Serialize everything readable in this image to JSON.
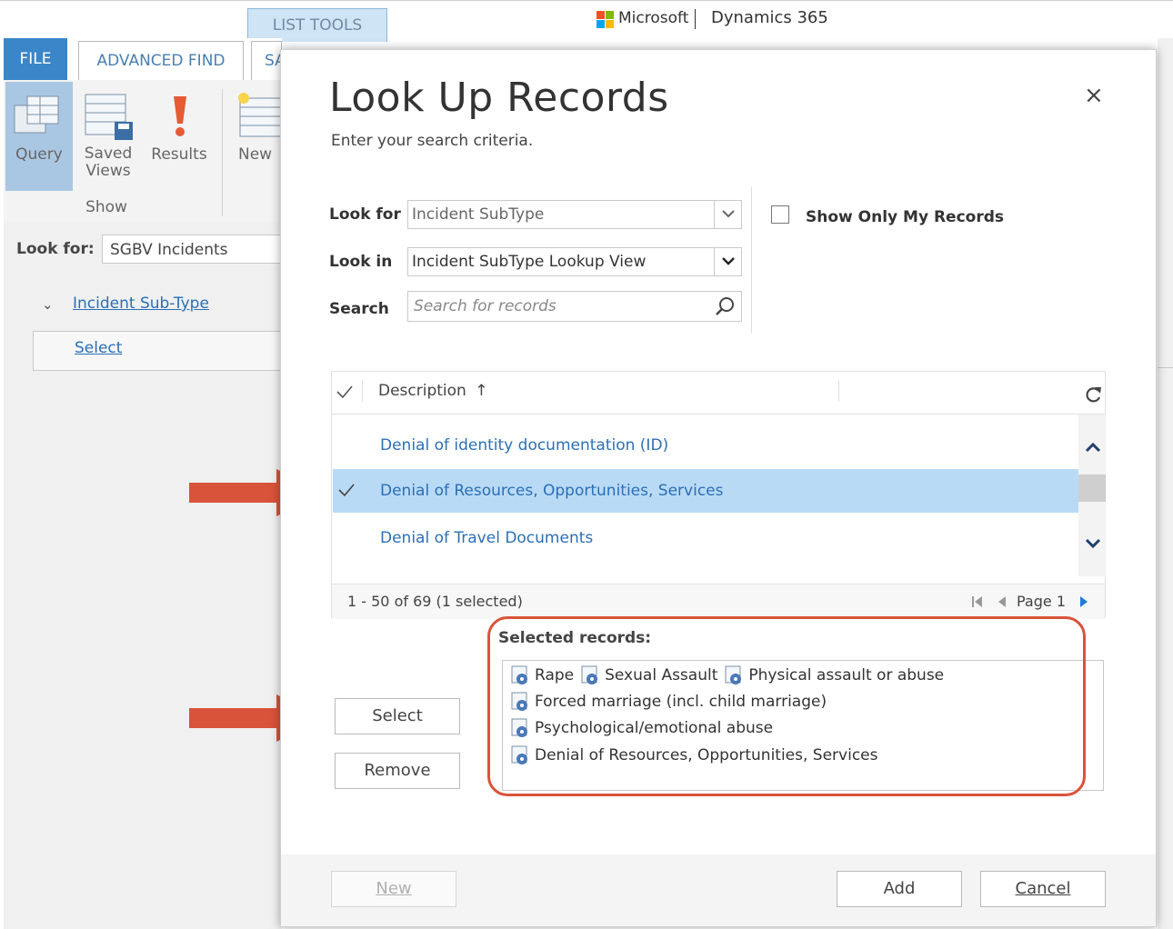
{
  "header": {
    "list_tools_tab": "LIST TOOLS",
    "brand_company": "Microsoft",
    "brand_app": "Dynamics 365"
  },
  "ribbon": {
    "file_tab": "FILE",
    "advanced_find_tab": "ADVANCED FIND",
    "partial_tab": "SA",
    "query_label": "Query",
    "saved_views_label_1": "Saved",
    "saved_views_label_2": "Views",
    "results_label": "Results",
    "new_label": "New",
    "group_label": "Show"
  },
  "background": {
    "look_for_label": "Look for:",
    "look_for_value": "SGBV Incidents",
    "subtype_link": "Incident Sub-Type",
    "select_link": "Select"
  },
  "dialog": {
    "title": "Look Up Records",
    "subtitle": "Enter your search criteria.",
    "close_glyph": "×",
    "look_for_label": "Look for",
    "look_for_value": "Incident SubType",
    "look_in_label": "Look in",
    "look_in_value": "Incident SubType Lookup View",
    "search_label": "Search",
    "search_placeholder": "Search for records",
    "show_only_mine_label": "Show Only My Records",
    "grid": {
      "column_header": "Description",
      "sort_glyph": "↑",
      "rows": [
        "Denial of identity documentation (ID)",
        "Denial of Resources, Opportunities, Services",
        "Denial of Travel Documents"
      ],
      "selected_row_index": 1,
      "status": "1 - 50 of 69 (1 selected)",
      "page_label": "Page 1"
    },
    "selected_records": {
      "label": "Selected records:",
      "lines": [
        [
          "Rape",
          "Sexual Assault",
          "Physical assault or abuse"
        ],
        [
          "Forced marriage (incl. child marriage)"
        ],
        [
          "Psychological/emotional abuse"
        ],
        [
          "Denial of Resources, Opportunities, Services"
        ]
      ]
    },
    "buttons": {
      "select": "Select",
      "remove": "Remove",
      "new": "New",
      "add": "Add",
      "cancel": "Cancel"
    }
  },
  "colors": {
    "accent_blue": "#3a86c8",
    "link_blue": "#2b6fb5",
    "selected_row": "#b9daf5",
    "annotation_red": "#d9533a"
  }
}
